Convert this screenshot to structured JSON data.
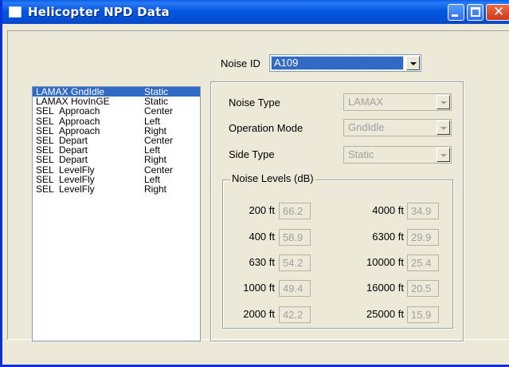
{
  "window": {
    "title": "Helicopter NPD Data"
  },
  "noise_id": {
    "label": "Noise ID",
    "value": "A109"
  },
  "noise_list": [
    {
      "c1": "LAMAX",
      "c2": "GndIdle",
      "c3": "Static",
      "selected": true,
      "lamax": true
    },
    {
      "c1": "LAMAX",
      "c2": "HovInGE",
      "c3": "Static",
      "selected": false,
      "lamax": true
    },
    {
      "c1": "SEL",
      "c2": "Approach",
      "c3": "Center"
    },
    {
      "c1": "SEL",
      "c2": "Approach",
      "c3": "Left"
    },
    {
      "c1": "SEL",
      "c2": "Approach",
      "c3": "Right"
    },
    {
      "c1": "SEL",
      "c2": "Depart",
      "c3": "Center"
    },
    {
      "c1": "SEL",
      "c2": "Depart",
      "c3": "Left"
    },
    {
      "c1": "SEL",
      "c2": "Depart",
      "c3": "Right"
    },
    {
      "c1": "SEL",
      "c2": "LevelFly",
      "c3": "Center"
    },
    {
      "c1": "SEL",
      "c2": "LevelFly",
      "c3": "Left"
    },
    {
      "c1": "SEL",
      "c2": "LevelFly",
      "c3": "Right"
    }
  ],
  "details": {
    "noise_type": {
      "label": "Noise Type",
      "value": "LAMAX"
    },
    "operation_mode": {
      "label": "Operation Mode",
      "value": "GndIdle"
    },
    "side_type": {
      "label": "Side Type",
      "value": "Static"
    }
  },
  "levels": {
    "title": "Noise Levels (dB)",
    "left": [
      {
        "label": "200 ft",
        "value": "66.2"
      },
      {
        "label": "400 ft",
        "value": "58.9"
      },
      {
        "label": "630 ft",
        "value": "54.2"
      },
      {
        "label": "1000 ft",
        "value": "49.4"
      },
      {
        "label": "2000 ft",
        "value": "42.2"
      }
    ],
    "right": [
      {
        "label": "4000 ft",
        "value": "34.9"
      },
      {
        "label": "6300 ft",
        "value": "29.9"
      },
      {
        "label": "10000 ft",
        "value": "25.4"
      },
      {
        "label": "16000 ft",
        "value": "20.5"
      },
      {
        "label": "25000 ft",
        "value": "15.9"
      }
    ]
  },
  "colors": {
    "titlebar": "#0554e0",
    "selection": "#316ac5",
    "face": "#ece9d8"
  }
}
